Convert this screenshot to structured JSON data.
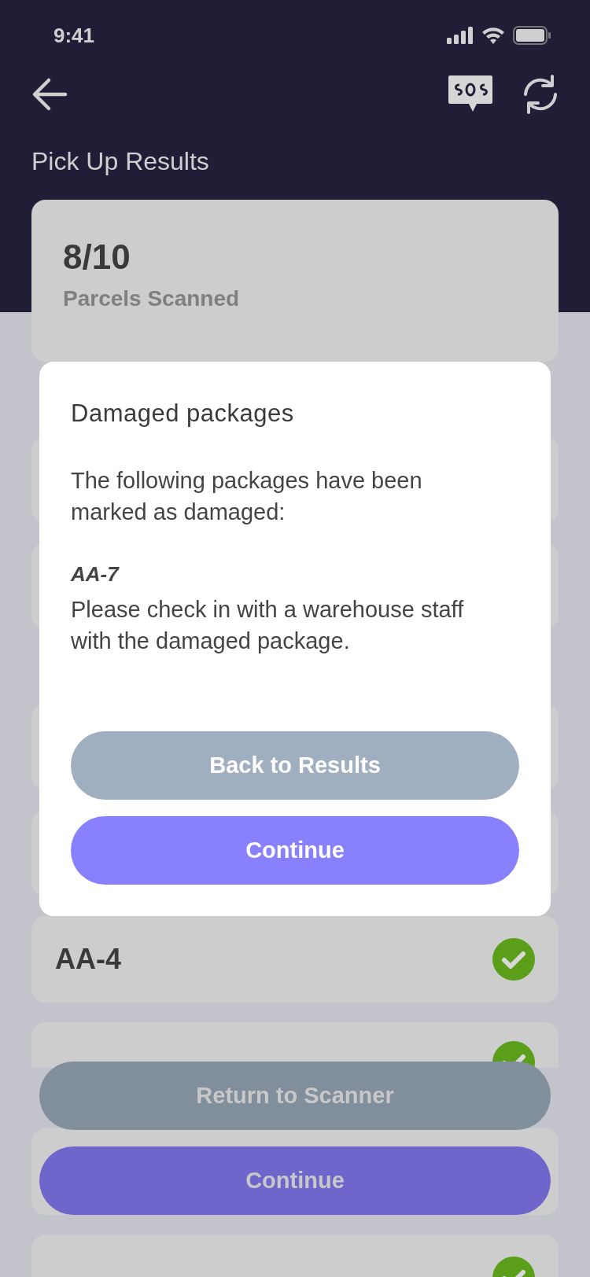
{
  "status_bar": {
    "time": "9:41"
  },
  "header": {
    "title": "Pick Up Results"
  },
  "summary": {
    "count": "8/10",
    "label": "Parcels Scanned"
  },
  "sections": [
    {
      "rows": [
        {
          "kind": "covered"
        },
        {
          "kind": "covered"
        }
      ]
    },
    {
      "rows": [
        {
          "kind": "covered"
        },
        {
          "kind": "covered"
        },
        {
          "kind": "parcel",
          "label": "AA-4",
          "scanned": true
        },
        {
          "kind": "tucked",
          "scanned": true
        },
        {
          "kind": "covered"
        },
        {
          "kind": "parcel",
          "scanned": true
        }
      ]
    }
  ],
  "dialog": {
    "title": "Damaged packages",
    "message": "The following packages have been marked as damaged:",
    "packages": [
      "AA-7"
    ],
    "note": "Please check in with a warehouse staff with the damaged package.",
    "buttons": [
      {
        "label": "Back to Results",
        "kind": "secondary"
      },
      {
        "label": "Continue",
        "kind": "primary"
      }
    ]
  },
  "footer_buttons": [
    {
      "label": "Return to Scanner",
      "kind": "secondary"
    },
    {
      "label": "Continue",
      "kind": "primary"
    }
  ]
}
